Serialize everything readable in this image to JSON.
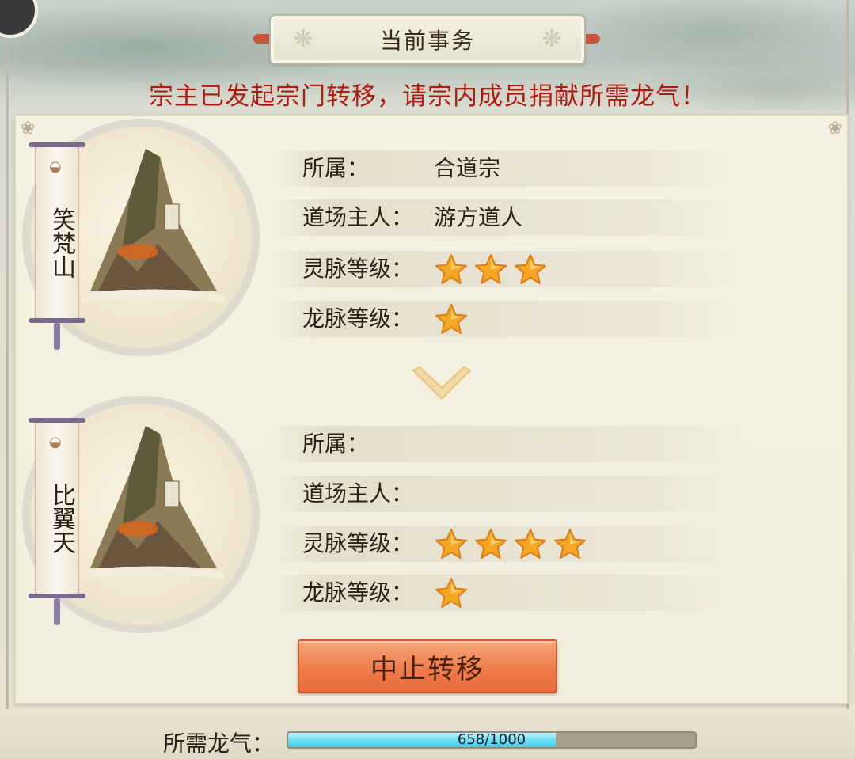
{
  "header": {
    "title": "当前事务",
    "notice": "宗主已发起宗门转移，请宗内成员捐献所需龙气！"
  },
  "current_location": {
    "name": "笑梵山",
    "affiliation_label": "所属：",
    "affiliation_value": "合道宗",
    "owner_label": "道场主人：",
    "owner_value": "游方道人",
    "spirit_vein_label": "灵脉等级：",
    "spirit_vein_stars": 3,
    "dragon_vein_label": "龙脉等级：",
    "dragon_vein_stars": 1
  },
  "target_location": {
    "name": "比翼天",
    "affiliation_label": "所属：",
    "affiliation_value": "",
    "owner_label": "道场主人：",
    "owner_value": "",
    "spirit_vein_label": "灵脉等级：",
    "spirit_vein_stars": 4,
    "dragon_vein_label": "龙脉等级：",
    "dragon_vein_stars": 1
  },
  "actions": {
    "stop_label": "中止转移"
  },
  "requirement": {
    "label": "所需龙气：",
    "current": 658,
    "total": 1000,
    "text": "658/1000"
  },
  "colors": {
    "notice": "#b01b10",
    "star": "#f5a623",
    "button": "#ef7d4c",
    "progress": "#6fe0f6"
  }
}
